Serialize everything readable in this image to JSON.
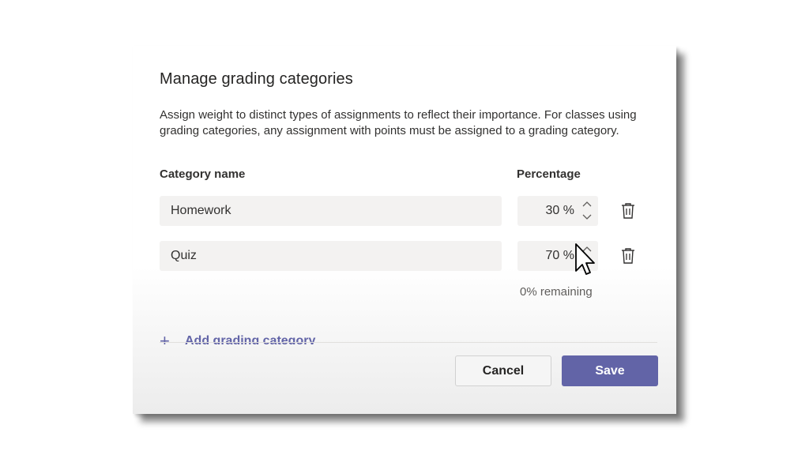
{
  "dialog": {
    "title": "Manage grading categories",
    "description": "Assign weight to distinct types of assignments to reflect their importance. For classes using grading categories, any assignment with points must be assigned to a grading category."
  },
  "columns": {
    "name": "Category name",
    "percentage": "Percentage"
  },
  "categories": [
    {
      "name": "Homework",
      "percent": "30",
      "unit": "%"
    },
    {
      "name": "Quiz",
      "percent": "70",
      "unit": "%"
    }
  ],
  "remaining": "0% remaining",
  "add_category": {
    "icon": "plus-icon",
    "label": "Add grading category"
  },
  "buttons": {
    "cancel": "Cancel",
    "save": "Save"
  },
  "icons": {
    "up": "chevron-up-icon",
    "down": "chevron-down-icon",
    "delete": "trash-icon"
  },
  "colors": {
    "accent": "#6264a7",
    "field_bg": "#f3f2f1",
    "text": "#252423",
    "muted": "#605e5c"
  }
}
